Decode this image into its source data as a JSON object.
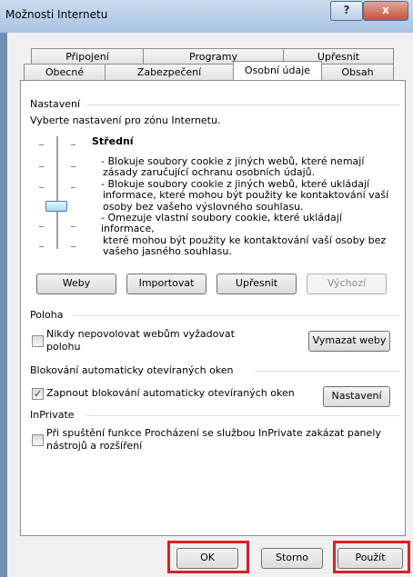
{
  "window": {
    "title": "Možnosti Internetu",
    "help_glyph": "?",
    "close_glyph": "x"
  },
  "tabs_row1": [
    "Připojení",
    "Programy",
    "Upřesnit"
  ],
  "tabs_row2": [
    "Obecné",
    "Zabezpečení",
    "Osobní údaje",
    "Obsah"
  ],
  "active_tab": "Osobní údaje",
  "nastaveni": {
    "label": "Nastavení",
    "zone_text": "Vyberte nastavení pro zónu Internetu.",
    "level": "Střední",
    "description": [
      "- Blokuje soubory cookie z jiných webů, které nemají",
      "zásady zaručující ochranu osobních údajů.",
      "- Blokuje soubory cookie z jiných webů, které ukládají",
      "informace, které mohou být použity ke kontaktování vaší",
      "osoby bez vašeho výslovného souhlasu.",
      "- Omezuje vlastní soubory cookie, které ukládají informace,",
      "které mohou být použity ke kontaktování vaší osoby bez",
      "vašeho jasného souhlasu."
    ],
    "buttons": {
      "weby": "Weby",
      "importovat": "Importovat",
      "upresnit": "Upřesnit",
      "vychozi": "Výchozí"
    }
  },
  "poloha": {
    "label": "Poloha",
    "checkbox_line1": "Nikdy nepovolovat webům vyžadovat",
    "checkbox_line2": "polohu",
    "checked": false,
    "clear_button": "Vymazat weby"
  },
  "popup": {
    "label": "Blokování automaticky otevíraných oken",
    "checkbox": "Zapnout blokování automaticky otevíraných oken",
    "checked": true,
    "settings_button": "Nastavení"
  },
  "inprivate": {
    "label": "InPrivate",
    "checkbox_line1": "Při spuštění funkce Procházení se službou InPrivate zakázat panely",
    "checkbox_line2": "nástrojů a rozšíření",
    "checked": false
  },
  "footer": {
    "ok": "OK",
    "storno": "Storno",
    "pouzit": "Použít"
  },
  "highlight_color": "#d9202a"
}
